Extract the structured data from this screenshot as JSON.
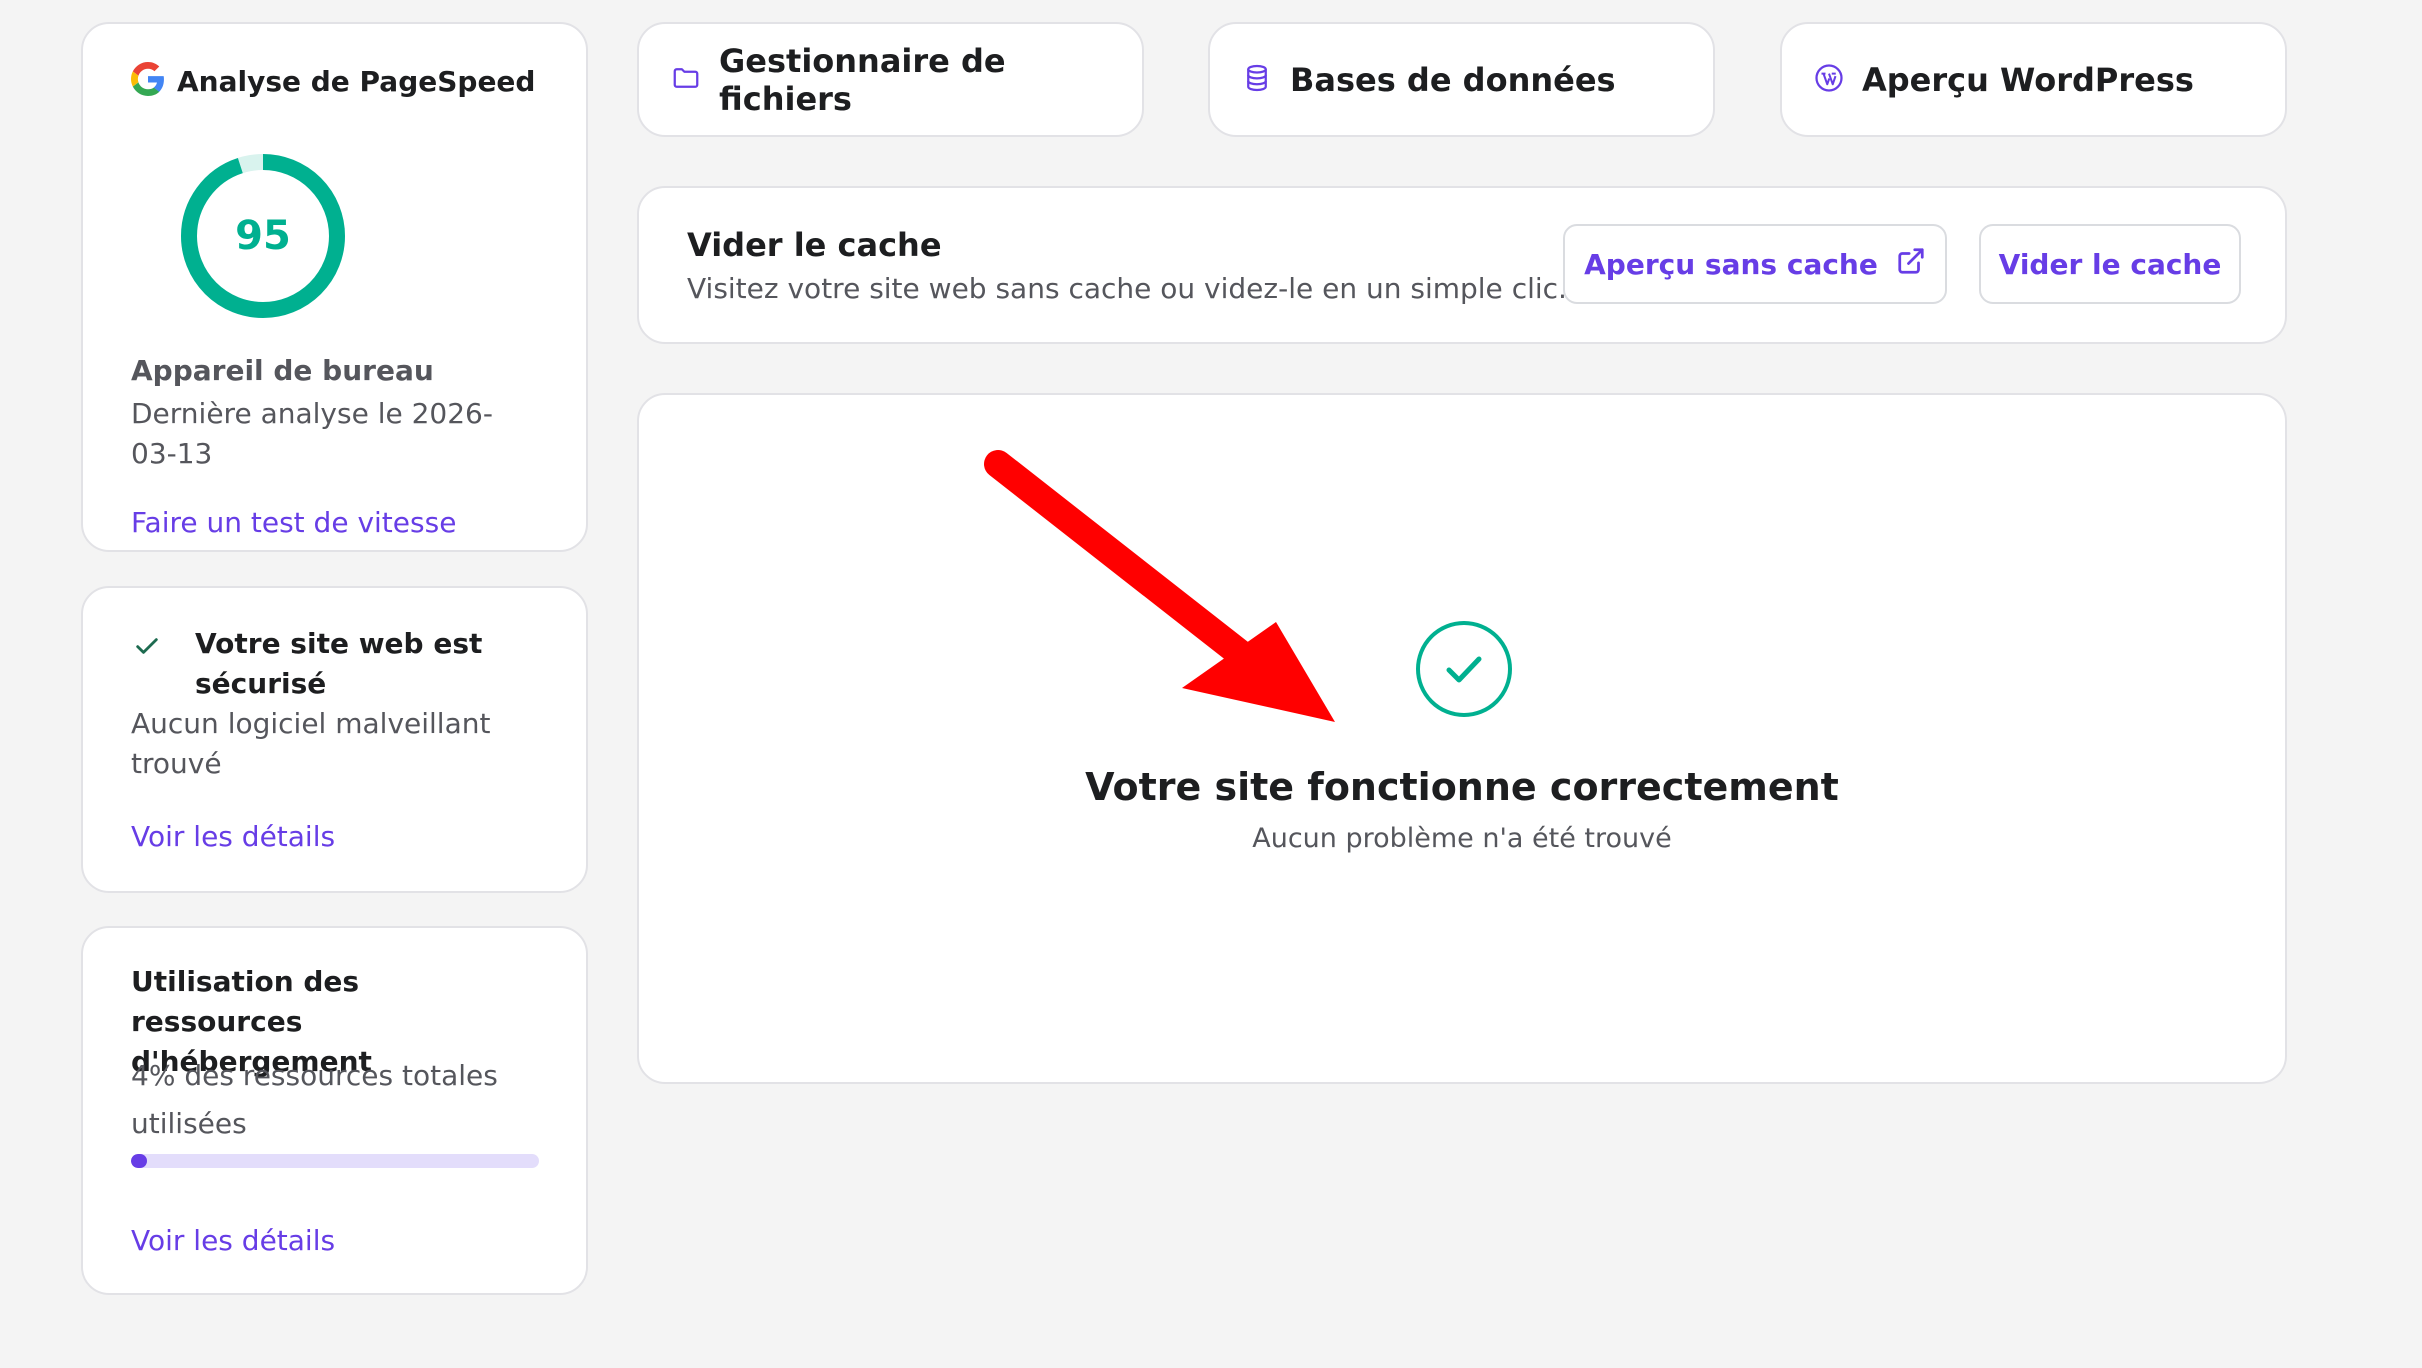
{
  "pagespeed": {
    "title": "Analyse de PageSpeed",
    "score": "95",
    "score_value": 95,
    "device": "Appareil de bureau",
    "last_analysis": "Dernière analyse le 2026-03-13",
    "link": "Faire un test de vitesse",
    "ring_color": "#00b090"
  },
  "security": {
    "title": "Votre site web est sécurisé",
    "subtitle": "Aucun logiciel malveillant trouvé",
    "link": "Voir les détails"
  },
  "resources": {
    "title": "Utilisation des ressources d'hébergement",
    "subtitle": "4% des ressources totales utilisées",
    "usage_percent": 4,
    "link": "Voir les détails"
  },
  "shortcuts": [
    {
      "label": "Gestionnaire de fichiers",
      "icon": "folder-icon"
    },
    {
      "label": "Bases de données",
      "icon": "database-icon"
    },
    {
      "label": "Aperçu WordPress",
      "icon": "wordpress-icon"
    }
  ],
  "cache": {
    "title": "Vider le cache",
    "description": "Visitez votre site web sans cache ou videz-le en un simple clic.",
    "preview_button": "Aperçu sans cache",
    "clear_button": "Vider le cache"
  },
  "status": {
    "title": "Votre site fonctionne correctement",
    "subtitle": "Aucun problème n'a été trouvé"
  },
  "colors": {
    "accent": "#673de6",
    "success": "#00b090",
    "annotation": "#ff0000"
  }
}
